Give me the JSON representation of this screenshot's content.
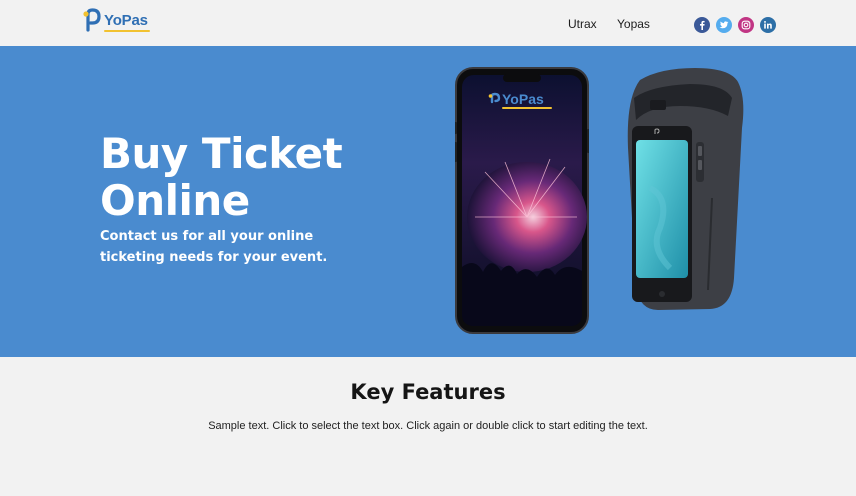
{
  "header": {
    "logo_text": "YoPas",
    "logo_icon": "yopas-p-icon",
    "nav": [
      "Utrax",
      "Yopas"
    ],
    "social": [
      {
        "name": "facebook-icon",
        "color": "#3b5998"
      },
      {
        "name": "twitter-icon",
        "color": "#55acee"
      },
      {
        "name": "instagram-icon",
        "color": "#c13584"
      },
      {
        "name": "linkedin-icon",
        "color": "#2d6fa7"
      }
    ]
  },
  "hero": {
    "title": "Buy Ticket Online",
    "subtitle": "Contact us for all your online ticketing needs for your event.",
    "phone_logo_text": "YoPas",
    "background": "#4a8bcf"
  },
  "features": {
    "title": "Key Features",
    "text": "Sample text. Click to select the text box. Click again or double click to start editing the text."
  }
}
